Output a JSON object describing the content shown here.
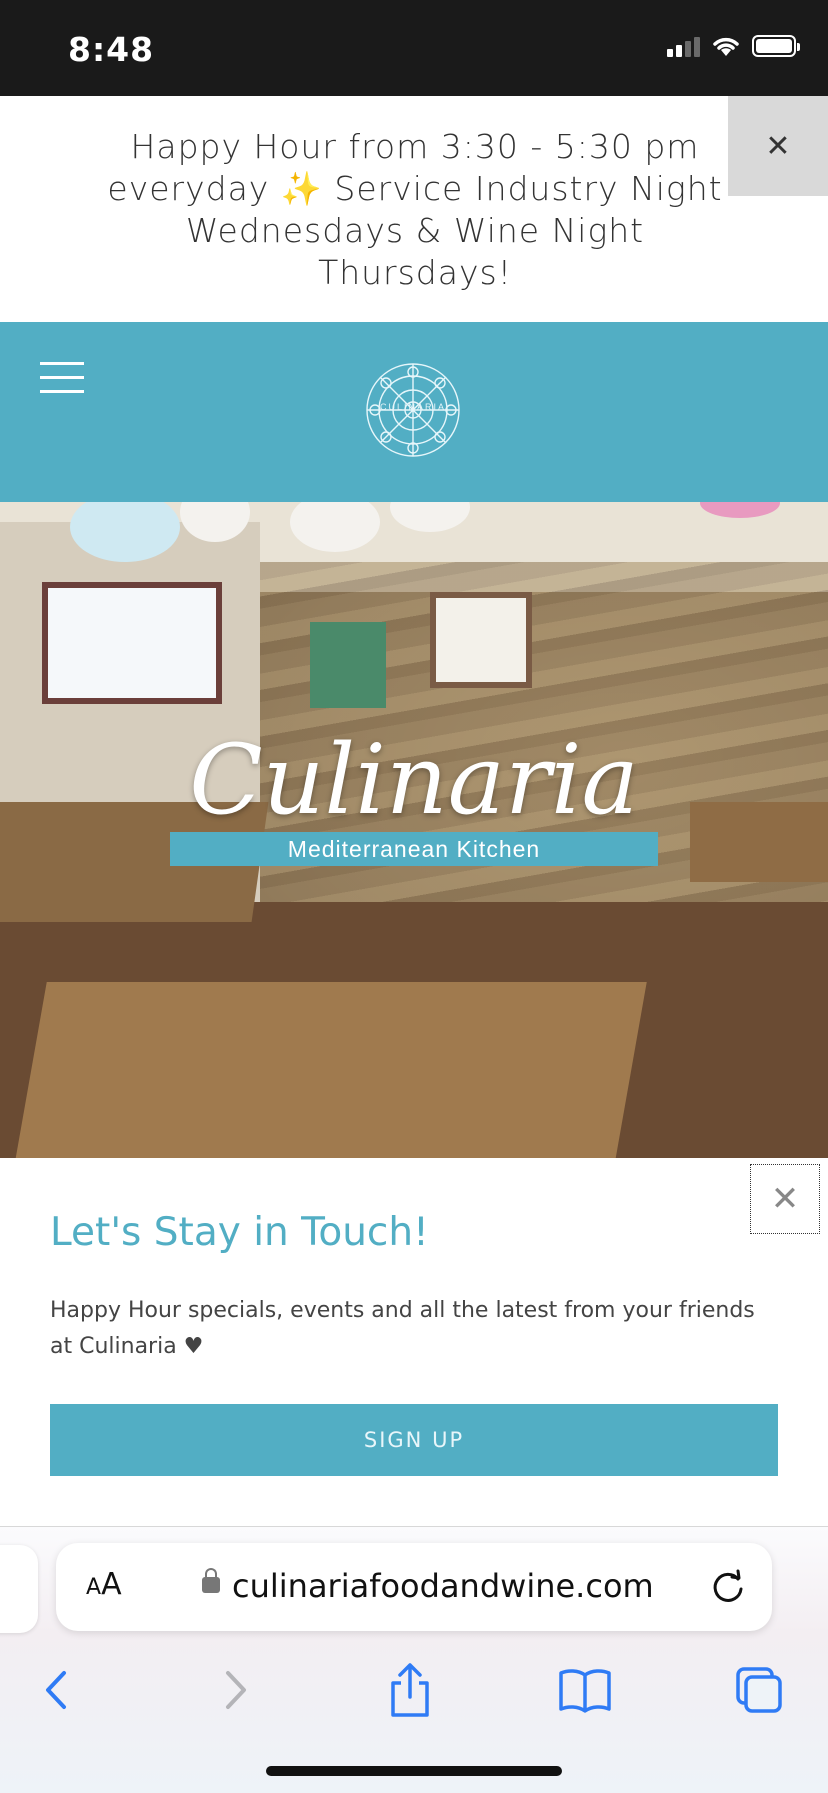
{
  "status_bar": {
    "time": "8:48"
  },
  "announcement": {
    "text": "Happy Hour from 3:30 - 5:30 pm everyday ✨ Service Industry Night Wednesdays &  Wine Night Thursdays!",
    "close_label": "✕"
  },
  "header": {
    "logo_text": "CULINARIA"
  },
  "hero": {
    "title": "Culinaria",
    "tagline": "Mediterranean Kitchen"
  },
  "popup": {
    "title": "Let's Stay in Touch!",
    "body": "Happy Hour specials, events and all the latest from your friends at Culinaria ♥",
    "button_label": "SIGN UP",
    "close_label": "✕"
  },
  "browser": {
    "text_size_label": "AA",
    "url": "culinariafoodandwine.com"
  },
  "icons": {
    "back": "chevron-left-icon",
    "forward": "chevron-right-icon",
    "share": "share-icon",
    "bookmarks": "book-icon",
    "tabs": "tabs-icon"
  },
  "colors": {
    "brand_teal": "#52aec4",
    "safari_blue": "#2f7bf5"
  }
}
